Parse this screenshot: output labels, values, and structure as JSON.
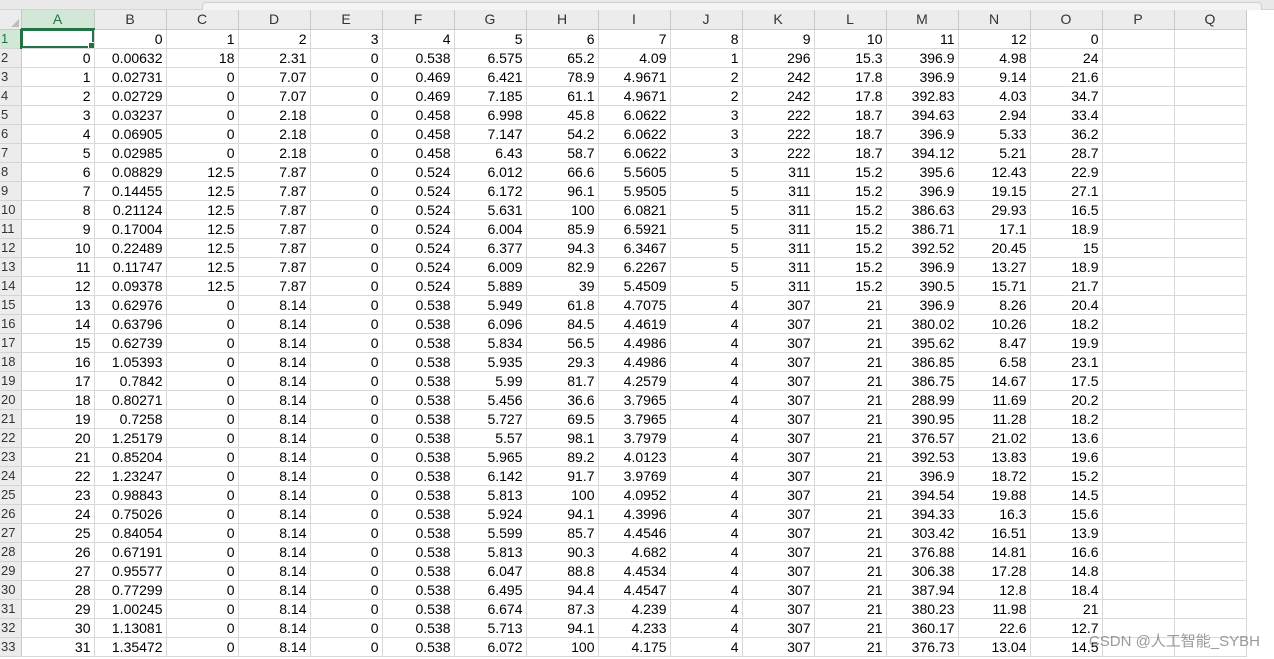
{
  "sheet": {
    "column_letters": [
      "A",
      "B",
      "C",
      "D",
      "E",
      "F",
      "G",
      "H",
      "I",
      "J",
      "K",
      "L",
      "M",
      "N",
      "O",
      "P",
      "Q"
    ],
    "active_column": "A",
    "active_row": "1",
    "rows": [
      {
        "n": "1",
        "cells": [
          "",
          "0",
          "1",
          "2",
          "3",
          "4",
          "5",
          "6",
          "7",
          "8",
          "9",
          "10",
          "11",
          "12",
          "0",
          "",
          ""
        ]
      },
      {
        "n": "2",
        "cells": [
          "0",
          "0.00632",
          "18",
          "2.31",
          "0",
          "0.538",
          "6.575",
          "65.2",
          "4.09",
          "1",
          "296",
          "15.3",
          "396.9",
          "4.98",
          "24",
          "",
          ""
        ]
      },
      {
        "n": "3",
        "cells": [
          "1",
          "0.02731",
          "0",
          "7.07",
          "0",
          "0.469",
          "6.421",
          "78.9",
          "4.9671",
          "2",
          "242",
          "17.8",
          "396.9",
          "9.14",
          "21.6",
          "",
          ""
        ]
      },
      {
        "n": "4",
        "cells": [
          "2",
          "0.02729",
          "0",
          "7.07",
          "0",
          "0.469",
          "7.185",
          "61.1",
          "4.9671",
          "2",
          "242",
          "17.8",
          "392.83",
          "4.03",
          "34.7",
          "",
          ""
        ]
      },
      {
        "n": "5",
        "cells": [
          "3",
          "0.03237",
          "0",
          "2.18",
          "0",
          "0.458",
          "6.998",
          "45.8",
          "6.0622",
          "3",
          "222",
          "18.7",
          "394.63",
          "2.94",
          "33.4",
          "",
          ""
        ]
      },
      {
        "n": "6",
        "cells": [
          "4",
          "0.06905",
          "0",
          "2.18",
          "0",
          "0.458",
          "7.147",
          "54.2",
          "6.0622",
          "3",
          "222",
          "18.7",
          "396.9",
          "5.33",
          "36.2",
          "",
          ""
        ]
      },
      {
        "n": "7",
        "cells": [
          "5",
          "0.02985",
          "0",
          "2.18",
          "0",
          "0.458",
          "6.43",
          "58.7",
          "6.0622",
          "3",
          "222",
          "18.7",
          "394.12",
          "5.21",
          "28.7",
          "",
          ""
        ]
      },
      {
        "n": "8",
        "cells": [
          "6",
          "0.08829",
          "12.5",
          "7.87",
          "0",
          "0.524",
          "6.012",
          "66.6",
          "5.5605",
          "5",
          "311",
          "15.2",
          "395.6",
          "12.43",
          "22.9",
          "",
          ""
        ]
      },
      {
        "n": "9",
        "cells": [
          "7",
          "0.14455",
          "12.5",
          "7.87",
          "0",
          "0.524",
          "6.172",
          "96.1",
          "5.9505",
          "5",
          "311",
          "15.2",
          "396.9",
          "19.15",
          "27.1",
          "",
          ""
        ]
      },
      {
        "n": "10",
        "cells": [
          "8",
          "0.21124",
          "12.5",
          "7.87",
          "0",
          "0.524",
          "5.631",
          "100",
          "6.0821",
          "5",
          "311",
          "15.2",
          "386.63",
          "29.93",
          "16.5",
          "",
          ""
        ]
      },
      {
        "n": "11",
        "cells": [
          "9",
          "0.17004",
          "12.5",
          "7.87",
          "0",
          "0.524",
          "6.004",
          "85.9",
          "6.5921",
          "5",
          "311",
          "15.2",
          "386.71",
          "17.1",
          "18.9",
          "",
          ""
        ]
      },
      {
        "n": "12",
        "cells": [
          "10",
          "0.22489",
          "12.5",
          "7.87",
          "0",
          "0.524",
          "6.377",
          "94.3",
          "6.3467",
          "5",
          "311",
          "15.2",
          "392.52",
          "20.45",
          "15",
          "",
          ""
        ]
      },
      {
        "n": "13",
        "cells": [
          "11",
          "0.11747",
          "12.5",
          "7.87",
          "0",
          "0.524",
          "6.009",
          "82.9",
          "6.2267",
          "5",
          "311",
          "15.2",
          "396.9",
          "13.27",
          "18.9",
          "",
          ""
        ]
      },
      {
        "n": "14",
        "cells": [
          "12",
          "0.09378",
          "12.5",
          "7.87",
          "0",
          "0.524",
          "5.889",
          "39",
          "5.4509",
          "5",
          "311",
          "15.2",
          "390.5",
          "15.71",
          "21.7",
          "",
          ""
        ]
      },
      {
        "n": "15",
        "cells": [
          "13",
          "0.62976",
          "0",
          "8.14",
          "0",
          "0.538",
          "5.949",
          "61.8",
          "4.7075",
          "4",
          "307",
          "21",
          "396.9",
          "8.26",
          "20.4",
          "",
          ""
        ]
      },
      {
        "n": "16",
        "cells": [
          "14",
          "0.63796",
          "0",
          "8.14",
          "0",
          "0.538",
          "6.096",
          "84.5",
          "4.4619",
          "4",
          "307",
          "21",
          "380.02",
          "10.26",
          "18.2",
          "",
          ""
        ]
      },
      {
        "n": "17",
        "cells": [
          "15",
          "0.62739",
          "0",
          "8.14",
          "0",
          "0.538",
          "5.834",
          "56.5",
          "4.4986",
          "4",
          "307",
          "21",
          "395.62",
          "8.47",
          "19.9",
          "",
          ""
        ]
      },
      {
        "n": "18",
        "cells": [
          "16",
          "1.05393",
          "0",
          "8.14",
          "0",
          "0.538",
          "5.935",
          "29.3",
          "4.4986",
          "4",
          "307",
          "21",
          "386.85",
          "6.58",
          "23.1",
          "",
          ""
        ]
      },
      {
        "n": "19",
        "cells": [
          "17",
          "0.7842",
          "0",
          "8.14",
          "0",
          "0.538",
          "5.99",
          "81.7",
          "4.2579",
          "4",
          "307",
          "21",
          "386.75",
          "14.67",
          "17.5",
          "",
          ""
        ]
      },
      {
        "n": "20",
        "cells": [
          "18",
          "0.80271",
          "0",
          "8.14",
          "0",
          "0.538",
          "5.456",
          "36.6",
          "3.7965",
          "4",
          "307",
          "21",
          "288.99",
          "11.69",
          "20.2",
          "",
          ""
        ]
      },
      {
        "n": "21",
        "cells": [
          "19",
          "0.7258",
          "0",
          "8.14",
          "0",
          "0.538",
          "5.727",
          "69.5",
          "3.7965",
          "4",
          "307",
          "21",
          "390.95",
          "11.28",
          "18.2",
          "",
          ""
        ]
      },
      {
        "n": "22",
        "cells": [
          "20",
          "1.25179",
          "0",
          "8.14",
          "0",
          "0.538",
          "5.57",
          "98.1",
          "3.7979",
          "4",
          "307",
          "21",
          "376.57",
          "21.02",
          "13.6",
          "",
          ""
        ]
      },
      {
        "n": "23",
        "cells": [
          "21",
          "0.85204",
          "0",
          "8.14",
          "0",
          "0.538",
          "5.965",
          "89.2",
          "4.0123",
          "4",
          "307",
          "21",
          "392.53",
          "13.83",
          "19.6",
          "",
          ""
        ]
      },
      {
        "n": "24",
        "cells": [
          "22",
          "1.23247",
          "0",
          "8.14",
          "0",
          "0.538",
          "6.142",
          "91.7",
          "3.9769",
          "4",
          "307",
          "21",
          "396.9",
          "18.72",
          "15.2",
          "",
          ""
        ]
      },
      {
        "n": "25",
        "cells": [
          "23",
          "0.98843",
          "0",
          "8.14",
          "0",
          "0.538",
          "5.813",
          "100",
          "4.0952",
          "4",
          "307",
          "21",
          "394.54",
          "19.88",
          "14.5",
          "",
          ""
        ]
      },
      {
        "n": "26",
        "cells": [
          "24",
          "0.75026",
          "0",
          "8.14",
          "0",
          "0.538",
          "5.924",
          "94.1",
          "4.3996",
          "4",
          "307",
          "21",
          "394.33",
          "16.3",
          "15.6",
          "",
          ""
        ]
      },
      {
        "n": "27",
        "cells": [
          "25",
          "0.84054",
          "0",
          "8.14",
          "0",
          "0.538",
          "5.599",
          "85.7",
          "4.4546",
          "4",
          "307",
          "21",
          "303.42",
          "16.51",
          "13.9",
          "",
          ""
        ]
      },
      {
        "n": "28",
        "cells": [
          "26",
          "0.67191",
          "0",
          "8.14",
          "0",
          "0.538",
          "5.813",
          "90.3",
          "4.682",
          "4",
          "307",
          "21",
          "376.88",
          "14.81",
          "16.6",
          "",
          ""
        ]
      },
      {
        "n": "29",
        "cells": [
          "27",
          "0.95577",
          "0",
          "8.14",
          "0",
          "0.538",
          "6.047",
          "88.8",
          "4.4534",
          "4",
          "307",
          "21",
          "306.38",
          "17.28",
          "14.8",
          "",
          ""
        ]
      },
      {
        "n": "30",
        "cells": [
          "28",
          "0.77299",
          "0",
          "8.14",
          "0",
          "0.538",
          "6.495",
          "94.4",
          "4.4547",
          "4",
          "307",
          "21",
          "387.94",
          "12.8",
          "18.4",
          "",
          ""
        ]
      },
      {
        "n": "31",
        "cells": [
          "29",
          "1.00245",
          "0",
          "8.14",
          "0",
          "0.538",
          "6.674",
          "87.3",
          "4.239",
          "4",
          "307",
          "21",
          "380.23",
          "11.98",
          "21",
          "",
          ""
        ]
      },
      {
        "n": "32",
        "cells": [
          "30",
          "1.13081",
          "0",
          "8.14",
          "0",
          "0.538",
          "5.713",
          "94.1",
          "4.233",
          "4",
          "307",
          "21",
          "360.17",
          "22.6",
          "12.7",
          "",
          ""
        ]
      },
      {
        "n": "33",
        "cells": [
          "31",
          "1.35472",
          "0",
          "8.14",
          "0",
          "0.538",
          "6.072",
          "100",
          "4.175",
          "4",
          "307",
          "21",
          "376.73",
          "13.04",
          "14.5",
          "",
          ""
        ]
      }
    ]
  },
  "watermark": "CSDN @人工智能_SYBH"
}
